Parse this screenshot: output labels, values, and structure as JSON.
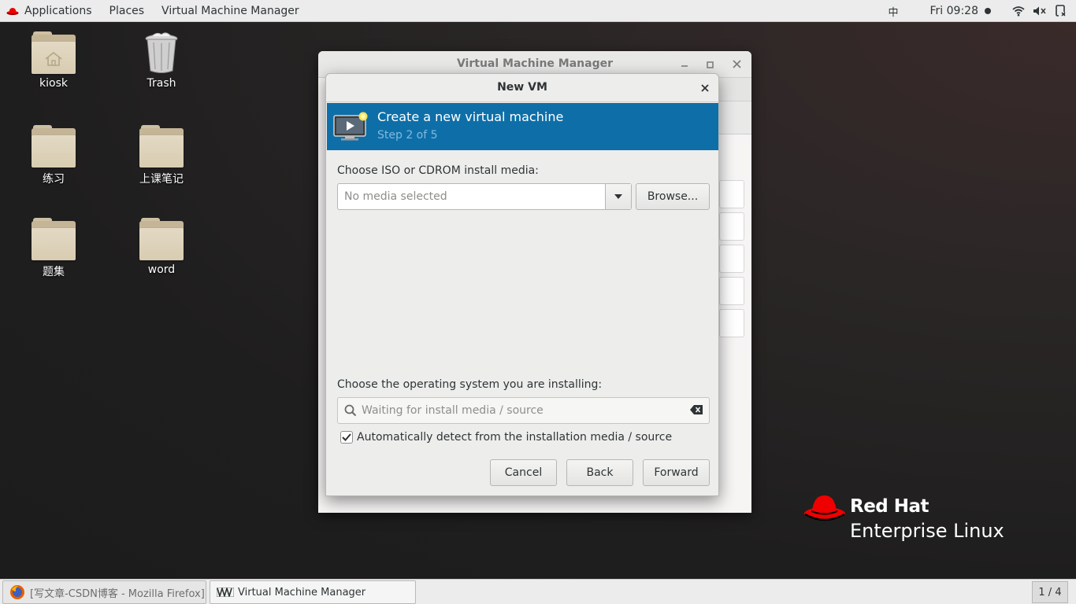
{
  "topbar": {
    "applications": "Applications",
    "places": "Places",
    "app_menu": "Virtual Machine Manager",
    "input_method": "中",
    "clock": "Fri 09:28"
  },
  "desktop": {
    "icons": [
      {
        "label": "kiosk",
        "type": "home-folder"
      },
      {
        "label": "Trash",
        "type": "trash"
      },
      {
        "label": "练习",
        "type": "folder"
      },
      {
        "label": "上课笔记",
        "type": "folder"
      },
      {
        "label": "题集",
        "type": "folder"
      },
      {
        "label": "word",
        "type": "folder"
      }
    ]
  },
  "vmm_window": {
    "title": "Virtual Machine Manager"
  },
  "dialog": {
    "title": "New VM",
    "banner_title": "Create a new virtual machine",
    "banner_step": "Step 2 of 5",
    "media_label": "Choose ISO or CDROM install media:",
    "media_placeholder": "No media selected",
    "browse_label": "Browse...",
    "os_label": "Choose the operating system you are installing:",
    "os_placeholder": "Waiting for install media / source",
    "autodetect_label": "Automatically detect from the installation media / source",
    "autodetect_checked": true,
    "cancel_label": "Cancel",
    "back_label": "Back",
    "forward_label": "Forward"
  },
  "branding": {
    "line1": "Red Hat",
    "line2": "Enterprise Linux"
  },
  "taskbar": {
    "tasks": [
      {
        "label": "[写文章-CSDN博客 - Mozilla Firefox]",
        "active": false
      },
      {
        "label": "Virtual Machine Manager",
        "active": true
      }
    ],
    "workspace": "1 / 4"
  },
  "colors": {
    "banner": "#0e6fa8",
    "redhat_red": "#ee0000"
  }
}
